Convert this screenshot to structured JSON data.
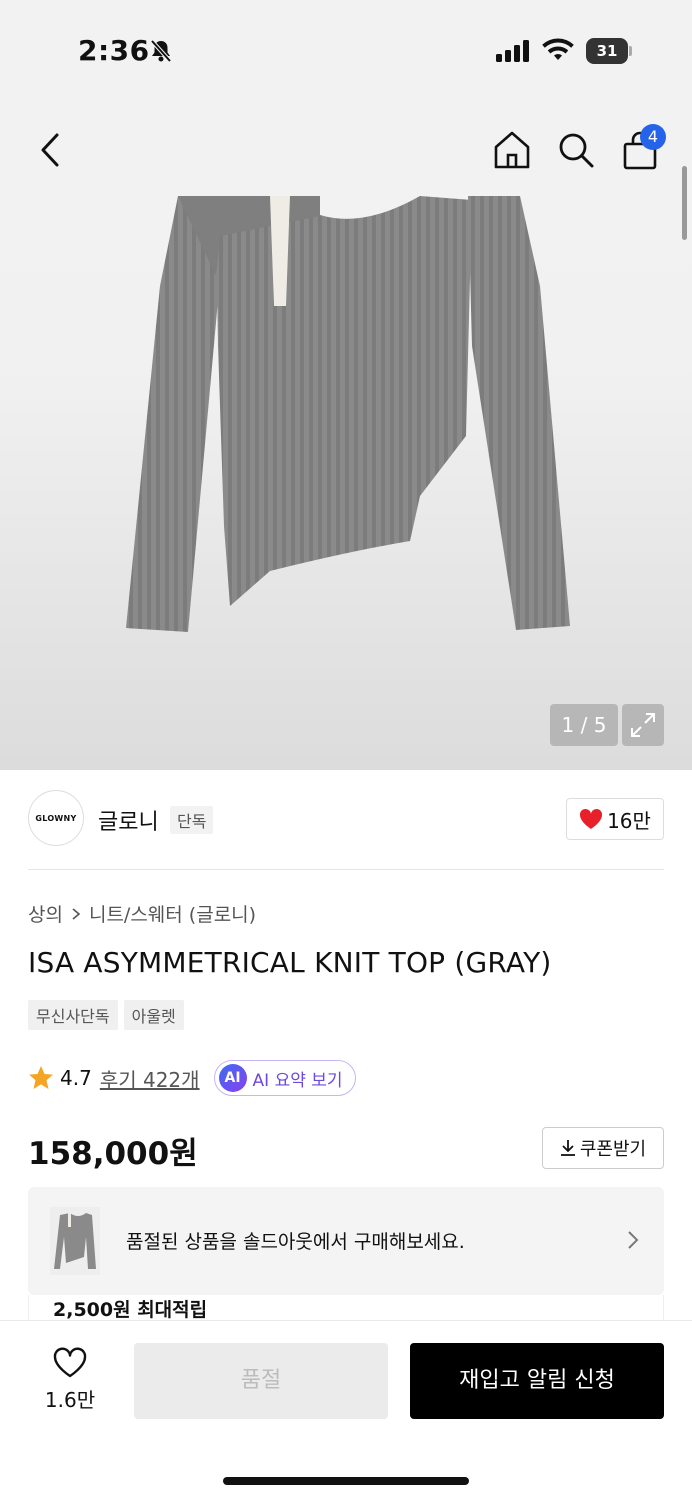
{
  "status_bar": {
    "time": "2:36",
    "battery": "31",
    "icons": [
      "bell-slash-icon",
      "signal-icon",
      "wifi-icon",
      "battery-icon"
    ]
  },
  "nav": {
    "icons": [
      "back-icon",
      "home-icon",
      "search-icon",
      "cart-icon"
    ],
    "cart_count": "4"
  },
  "gallery": {
    "counter": "1 / 5",
    "expand_icon": "expand-icon"
  },
  "brand": {
    "logo_text": "GLOWNY",
    "name": "글로니",
    "tag": "단독",
    "likes": "16만"
  },
  "breadcrumb": {
    "category": "상의",
    "subcategory": "니트/스웨터 (글로니)"
  },
  "product": {
    "title": "ISA ASYMMETRICAL KNIT TOP (GRAY)",
    "tags": [
      "무신사단독",
      "아울렛"
    ],
    "rating": "4.7",
    "review_link": "후기 422개",
    "ai_badge": "AI",
    "ai_label": "AI 요약 보기",
    "price": "158,000원",
    "coupon_label": "쿠폰받기"
  },
  "soldout_banner": {
    "text": "품절된 상품을 솔드아웃에서 구매해보세요."
  },
  "points": {
    "text": "2,500원 최대적립"
  },
  "bottom_bar": {
    "wish_count": "1.6만",
    "soldout_label": "품절",
    "restock_label": "재입고 알림 신청"
  },
  "colors": {
    "accent_blue": "#2563eb",
    "heart_red": "#e8202a",
    "star_orange": "#f5a524",
    "ai_purple": "#6d4adf"
  }
}
